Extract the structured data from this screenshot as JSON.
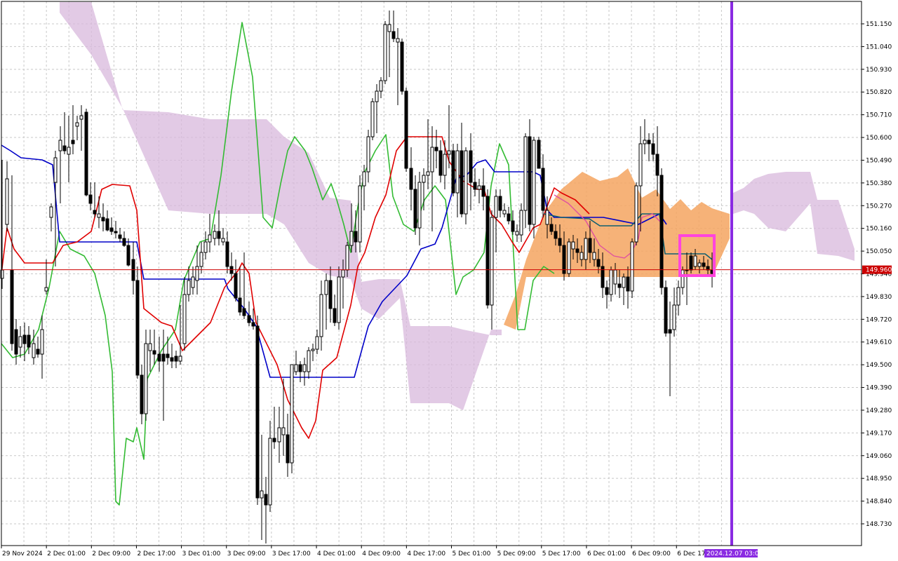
{
  "chart_data": {
    "type": "candlestick",
    "y_ticks": [
      "151.150",
      "151.040",
      "150.930",
      "150.820",
      "150.710",
      "150.600",
      "150.490",
      "150.380",
      "150.270",
      "150.160",
      "150.050",
      "149.940",
      "149.830",
      "149.720",
      "149.610",
      "149.500",
      "149.390",
      "149.280",
      "149.170",
      "149.060",
      "148.950",
      "148.840",
      "148.730"
    ],
    "y_tick_values": [
      151.15,
      151.04,
      150.93,
      150.82,
      150.71,
      150.6,
      150.49,
      150.38,
      150.27,
      150.16,
      150.05,
      149.94,
      149.83,
      149.72,
      149.61,
      149.5,
      149.39,
      149.28,
      149.17,
      149.06,
      148.95,
      148.84,
      148.73
    ],
    "x_ticks": [
      "29 Nov 2024",
      "2 Dec 01:00",
      "2 Dec 09:00",
      "2 Dec 17:00",
      "3 Dec 01:00",
      "3 Dec 09:00",
      "3 Dec 17:00",
      "4 Dec 01:00",
      "4 Dec 09:00",
      "4 Dec 17:00",
      "5 Dec 01:00",
      "5 Dec 09:00",
      "5 Dec 17:00",
      "6 Dec 01:00",
      "6 Dec 09:00",
      "6 Dec 17:00"
    ],
    "current_price": "149.960",
    "current_price_value": 149.96,
    "vline_label": "2024.12.07 03:00",
    "ylim": [
      148.66,
      151.26
    ],
    "grid": true,
    "colors": {
      "bull_candle": "#ffffff",
      "bear_candle": "#000000",
      "tenkan": "#e00000",
      "kijun": "#0000c8",
      "chikou": "#33bb33",
      "kumo_bear": "#d8b8dc",
      "kumo_bull": "#f4a460",
      "kijun_htf": "#106070",
      "tenkan_htf": "#e050a0",
      "vline": "#8a2be2",
      "highlight": "#ff44dd",
      "price_line": "#cc0000",
      "price_tag_bg": "#cc0000",
      "vline_tag_bg": "#8a2be2"
    }
  }
}
